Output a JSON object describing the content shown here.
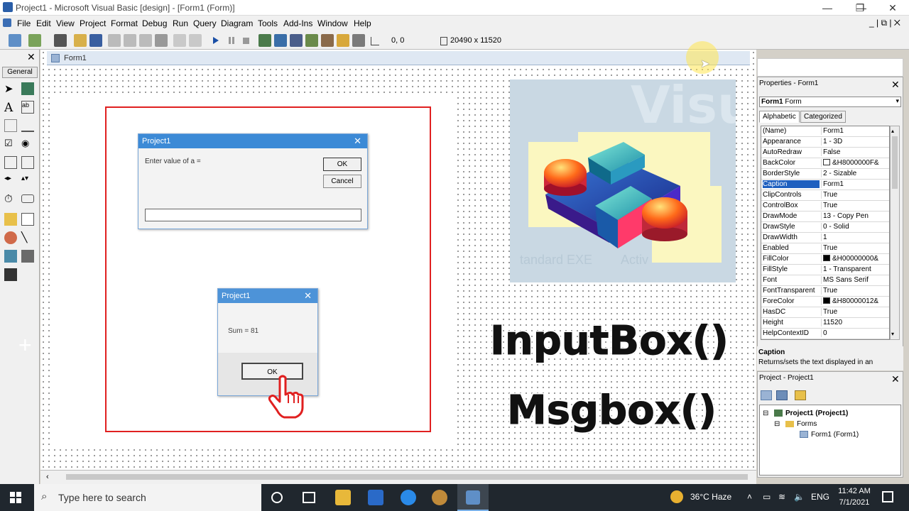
{
  "window": {
    "title": "Project1 - Microsoft Visual Basic [design] - [Form1 (Form)]",
    "minimize": "—",
    "maximize": "❐",
    "close": "✕"
  },
  "menu": {
    "items": [
      "File",
      "Edit",
      "View",
      "Project",
      "Format",
      "Debug",
      "Run",
      "Query",
      "Diagram",
      "Tools",
      "Add-Ins",
      "Window",
      "Help"
    ],
    "mdi_controls": "_ | ⧉ | ✕"
  },
  "toolbar": {
    "position": "0, 0",
    "size": "20490 x 11520"
  },
  "toolbox": {
    "close": "✕",
    "tab_label": "General"
  },
  "form_tab": {
    "label": "Form1"
  },
  "inputbox_dialog": {
    "title": "Project1",
    "prompt": "Enter value of a =",
    "ok_label": "OK",
    "cancel_label": "Cancel",
    "input_value": ""
  },
  "msgbox_dialog": {
    "title": "Project1",
    "message": "Sum = 81",
    "ok_label": "OK"
  },
  "overlay": {
    "line1": "InputBox()",
    "line2": "Msgbox()"
  },
  "properties": {
    "title": "Properties - Form1",
    "close": "✕",
    "object_name": "Form1",
    "object_type": "Form",
    "tab_alphabetic": "Alphabetic",
    "tab_categorized": "Categorized",
    "rows": [
      {
        "name": "(Name)",
        "value": "Form1"
      },
      {
        "name": "Appearance",
        "value": "1 - 3D"
      },
      {
        "name": "AutoRedraw",
        "value": "False"
      },
      {
        "name": "BackColor",
        "value": "&H8000000F&",
        "swatch": "#ffffff"
      },
      {
        "name": "BorderStyle",
        "value": "2 - Sizable"
      },
      {
        "name": "Caption",
        "value": "Form1",
        "selected": true
      },
      {
        "name": "ClipControls",
        "value": "True"
      },
      {
        "name": "ControlBox",
        "value": "True"
      },
      {
        "name": "DrawMode",
        "value": "13 - Copy Pen"
      },
      {
        "name": "DrawStyle",
        "value": "0 - Solid"
      },
      {
        "name": "DrawWidth",
        "value": "1"
      },
      {
        "name": "Enabled",
        "value": "True"
      },
      {
        "name": "FillColor",
        "value": "&H00000000&",
        "swatch": "#000000"
      },
      {
        "name": "FillStyle",
        "value": "1 - Transparent"
      },
      {
        "name": "Font",
        "value": "MS Sans Serif"
      },
      {
        "name": "FontTransparent",
        "value": "True"
      },
      {
        "name": "ForeColor",
        "value": "&H80000012&",
        "swatch": "#000000"
      },
      {
        "name": "HasDC",
        "value": "True"
      },
      {
        "name": "Height",
        "value": "11520"
      },
      {
        "name": "HelpContextID",
        "value": "0"
      }
    ],
    "desc_title": "Caption",
    "desc_text": "Returns/sets the text displayed in an"
  },
  "project": {
    "title": "Project - Project1",
    "close": "✕",
    "root": "Project1 (Project1)",
    "folder": "Forms",
    "item": "Form1 (Form1)"
  },
  "splash": {
    "watermark_text": "Visu",
    "label1": "tandard EXE",
    "label2": "Activ"
  },
  "taskbar": {
    "search_placeholder": "Type here to search",
    "weather": "36°C  Haze",
    "language": "ENG",
    "time": "11:42 AM",
    "date": "7/1/2021"
  }
}
